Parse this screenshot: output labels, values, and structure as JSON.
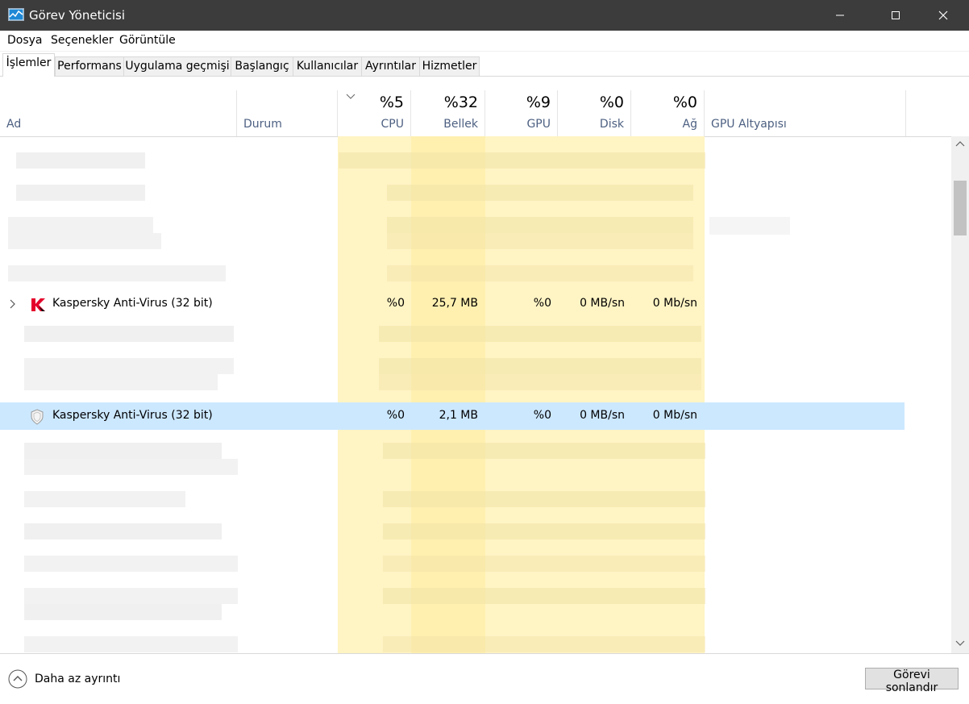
{
  "window": {
    "title": "Görev Yöneticisi"
  },
  "menu": {
    "items": [
      "Dosya",
      "Seçenekler",
      "Görüntüle"
    ]
  },
  "tabs": [
    "İşlemler",
    "Performans",
    "Uygulama geçmişi",
    "Başlangıç",
    "Kullanıcılar",
    "Ayrıntılar",
    "Hizmetler"
  ],
  "columns": {
    "name": "Ad",
    "status": "Durum",
    "cpu": {
      "percent": "%5",
      "label": "CPU"
    },
    "memory": {
      "percent": "%32",
      "label": "Bellek"
    },
    "gpu": {
      "percent": "%9",
      "label": "GPU"
    },
    "disk": {
      "percent": "%0",
      "label": "Disk"
    },
    "network": {
      "percent": "%0",
      "label": "Ağ"
    },
    "gpu_engine": "GPU Altyapısı"
  },
  "rows": [
    {
      "name": "Kaspersky Anti-Virus (32 bit)",
      "cpu": "%0",
      "memory": "25,7 MB",
      "gpu": "%0",
      "disk": "0 MB/sn",
      "network": "0 Mb/sn"
    },
    {
      "name": "Kaspersky Anti-Virus (32 bit)",
      "cpu": "%0",
      "memory": "2,1 MB",
      "gpu": "%0",
      "disk": "0 MB/sn",
      "network": "0 Mb/sn"
    }
  ],
  "footer": {
    "less_details": "Daha az ayrıntı",
    "end_task": "Görevi sonlandır"
  },
  "colors": {
    "titlebar": "#3c3c3c",
    "selected_row": "#cce8ff",
    "heat_column": "#fff4c4",
    "kaspersky_red": "#e4002b"
  }
}
